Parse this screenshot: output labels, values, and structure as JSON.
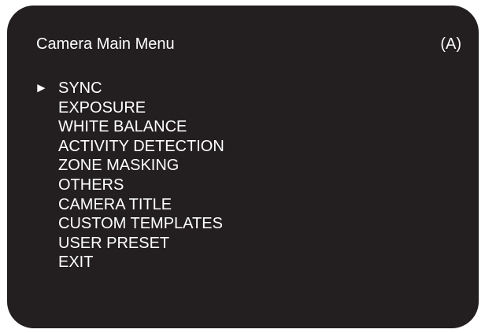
{
  "screen": {
    "background_color": "#231f20",
    "text_color": "#ffffff"
  },
  "header": {
    "title": "Camera Main Menu",
    "mode": "(A)"
  },
  "menu": {
    "cursor_icon": "right-triangle-pointer",
    "cursor_glyph": "►",
    "selected_index": 0,
    "items": [
      {
        "label": "SYNC"
      },
      {
        "label": "EXPOSURE"
      },
      {
        "label": "WHITE BALANCE"
      },
      {
        "label": "ACTIVITY DETECTION"
      },
      {
        "label": "ZONE MASKING"
      },
      {
        "label": "OTHERS"
      },
      {
        "label": "CAMERA TITLE"
      },
      {
        "label": "CUSTOM TEMPLATES"
      },
      {
        "label": "USER PRESET"
      },
      {
        "label": "EXIT"
      }
    ]
  }
}
